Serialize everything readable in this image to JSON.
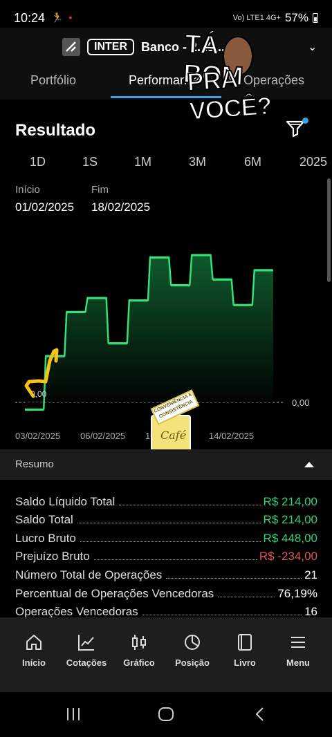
{
  "status_bar": {
    "time": "10:24",
    "notif_icons": "🏃 •",
    "network": "Vo) LTE1 4G+",
    "battery": "57%"
  },
  "header": {
    "broker_badge": "INTER",
    "account_label": "Banco - 2...9...",
    "sticker_line1": "TÁ BOM",
    "sticker_line2": "PRA VOCÊ?"
  },
  "tabs": [
    {
      "label": "Portfólio",
      "active": false
    },
    {
      "label": "Performance",
      "active": true
    },
    {
      "label": "Operações",
      "active": false
    }
  ],
  "result": {
    "title": "Resultado",
    "periods": [
      "1D",
      "1S",
      "1M",
      "3M",
      "6M",
      "2025"
    ],
    "start_label": "Início",
    "start_date": "01/02/2025",
    "end_label": "Fim",
    "end_date": "18/02/2025"
  },
  "chart_data": {
    "type": "area",
    "step": true,
    "x": [
      "03/02/2025",
      "04/02/2025",
      "05/02/2025",
      "06/02/2025",
      "07/02/2025",
      "10/02/2025",
      "11/02/2025",
      "12/02/2025",
      "13/02/2025",
      "14/02/2025",
      "17/02/2025",
      "18/02/2025"
    ],
    "values": [
      -30,
      200,
      390,
      450,
      255,
      440,
      625,
      505,
      635,
      530,
      420,
      570
    ],
    "xtick_labels": [
      "03/02/2025",
      "06/02/2025",
      "10/02/2025",
      "14/02/2025"
    ],
    "zero_label": "0,00",
    "zero_right_label": "0,00",
    "colors": {
      "line": "#33e07a",
      "fill_top": "#0f5a2c",
      "fill_bottom": "#000000",
      "zero_line": "#777777"
    }
  },
  "resumo": {
    "label": "Resumo",
    "rows": [
      {
        "label": "Saldo Líquido Total",
        "value": "R$ 214,00",
        "tone": "pos"
      },
      {
        "label": "Saldo Total",
        "value": "R$ 214,00",
        "tone": "pos"
      },
      {
        "label": "Lucro Bruto",
        "value": "R$ 448,00",
        "tone": "pos"
      },
      {
        "label": "Prejuízo Bruto",
        "value": "R$ -234,00",
        "tone": "neg"
      },
      {
        "label": "Número Total de Operações",
        "value": "21",
        "tone": "plain"
      },
      {
        "label": "Percentual de Operações Vencedoras",
        "value": "76,19%",
        "tone": "plain"
      },
      {
        "label": "Operações Vencedoras",
        "value": "16",
        "tone": "plain"
      }
    ]
  },
  "bottom_nav": [
    {
      "label": "Início",
      "icon": "home-icon"
    },
    {
      "label": "Cotações",
      "icon": "trend-chart-icon"
    },
    {
      "label": "Gráfico",
      "icon": "candlestick-icon"
    },
    {
      "label": "Posição",
      "icon": "pie-chart-icon"
    },
    {
      "label": "Livro",
      "icon": "book-icon"
    },
    {
      "label": "Menu",
      "icon": "hamburger-menu-icon"
    }
  ],
  "cafe_sticker": {
    "banner": "CONVENIÊNCIA E CONSISTÊNCIA",
    "script": "Café"
  }
}
